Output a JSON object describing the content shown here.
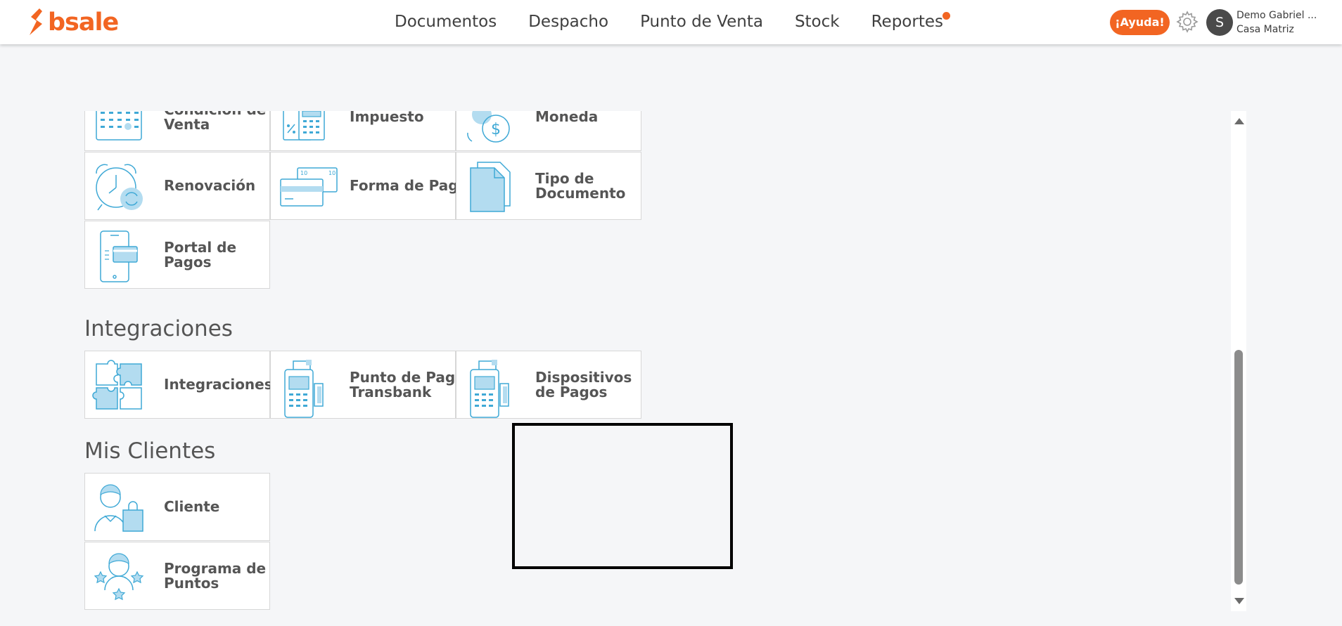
{
  "header": {
    "logo_text": "bsale",
    "nav": [
      "Documentos",
      "Despacho",
      "Punto de Venta",
      "Stock",
      "Reportes"
    ],
    "help_label": "¡Ayuda!",
    "avatar_initial": "S",
    "user_name": "Demo Gabriel ...",
    "user_branch": "Casa Matriz"
  },
  "tiles_top": [
    {
      "line1": "Condición de",
      "line2": "Venta",
      "icon": "calendar-icon"
    },
    {
      "line1": "Impuesto",
      "line2": "",
      "icon": "tax-calculator-icon"
    },
    {
      "line1": "Moneda",
      "line2": "",
      "icon": "currency-exchange-icon"
    },
    {
      "line1": "Renovación",
      "line2": "",
      "icon": "alarm-clock-refresh-icon"
    },
    {
      "line1": "Forma de Pago",
      "line2": "",
      "icon": "payment-cards-icon"
    },
    {
      "line1": "Tipo de",
      "line2": "Documento",
      "icon": "document-icon"
    },
    {
      "line1": "Portal de",
      "line2": "Pagos",
      "icon": "mobile-payment-icon"
    }
  ],
  "sections": {
    "integraciones": {
      "title": "Integraciones",
      "tiles": [
        {
          "line1": "Integraciones",
          "line2": "",
          "icon": "puzzle-icon"
        },
        {
          "line1": "Punto de Pago",
          "line2": "Transbank",
          "icon": "pos-terminal-icon"
        },
        {
          "line1": "Dispositivos",
          "line2": "de Pagos",
          "icon": "pos-terminal-icon"
        }
      ]
    },
    "clientes": {
      "title": "Mis Clientes",
      "tiles": [
        {
          "line1": "Cliente",
          "line2": "",
          "icon": "customer-shopping-icon"
        },
        {
          "line1": "Programa de",
          "line2": "Puntos",
          "icon": "loyalty-stars-icon"
        }
      ]
    }
  },
  "colors": {
    "brand_orange": "#f26522",
    "icon_blue": "#3fa9d6",
    "icon_fill": "#b3dcf0"
  }
}
